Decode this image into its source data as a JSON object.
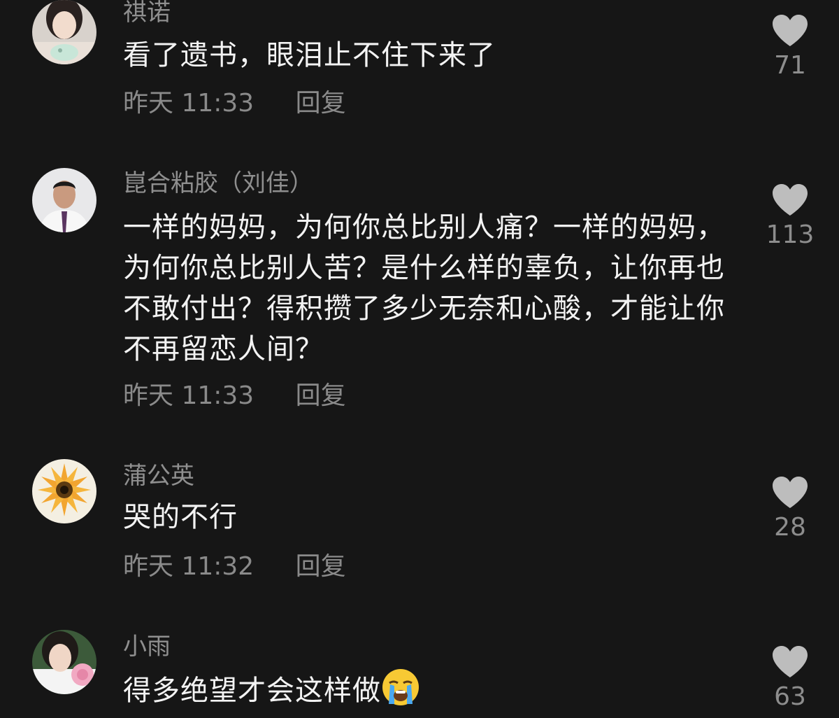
{
  "comments": [
    {
      "username": "祺诺",
      "text": "看了遗书，眼泪止不住下来了",
      "time": "昨天 11:33",
      "reply": "回复",
      "likes": "71"
    },
    {
      "username": "崑合粘胶（刘佳）",
      "text": "一样的妈妈，为何你总比别人痛？一样的妈妈，为何你总比别人苦？是什么样的辜负，让你再也不敢付出？得积攒了多少无奈和心酸，才能让你不再留恋人间？",
      "time": "昨天 11:33",
      "reply": "回复",
      "likes": "113"
    },
    {
      "username": "蒲公英",
      "text": "哭的不行",
      "time": "昨天 11:32",
      "reply": "回复",
      "likes": "28"
    },
    {
      "username": "小雨",
      "text": "得多绝望才会这样做",
      "emoji": "crying-face-emoji",
      "likes": "63"
    }
  ],
  "colors": {
    "background": "#161616",
    "username": "#8f8f8f",
    "text": "#f3f3f3",
    "meta": "#8a8a8a",
    "heart": "#bdbdbd"
  }
}
